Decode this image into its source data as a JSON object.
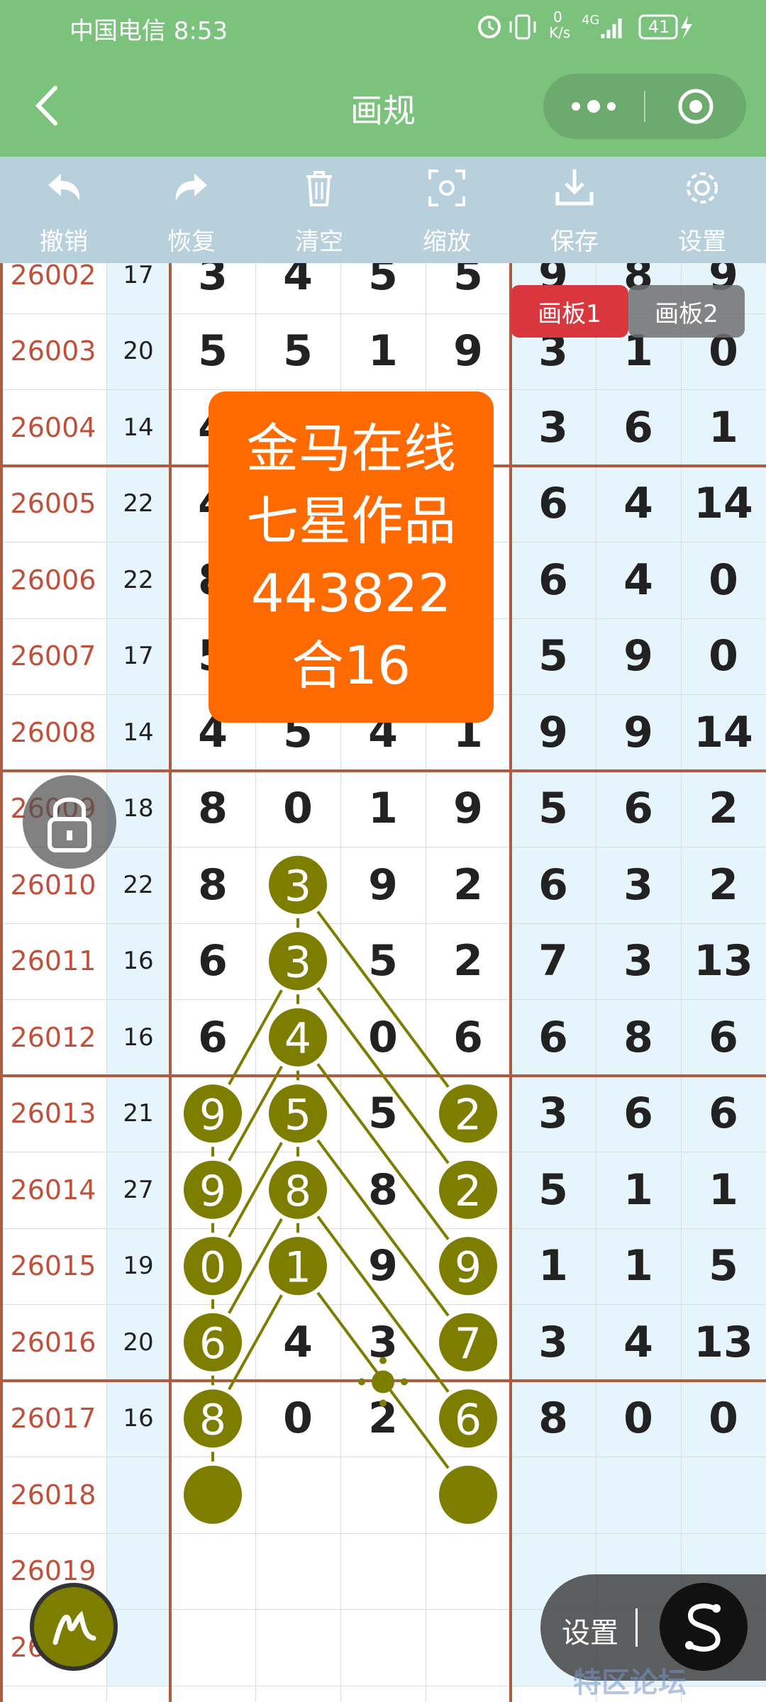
{
  "status_bar": {
    "carrier_time": "中国电信 8:53",
    "net_speed_value": "0",
    "net_speed_unit": "K/s",
    "network": "4G",
    "battery": "41"
  },
  "title_bar": {
    "title": "画规"
  },
  "toolbar": [
    {
      "label": "撤销",
      "icon": "undo-icon"
    },
    {
      "label": "恢复",
      "icon": "redo-icon"
    },
    {
      "label": "清空",
      "icon": "trash-icon"
    },
    {
      "label": "缩放",
      "icon": "zoom-icon"
    },
    {
      "label": "保存",
      "icon": "download-icon"
    },
    {
      "label": "设置",
      "icon": "gear-icon"
    }
  ],
  "board_tabs": [
    {
      "label": "画板1",
      "active": true
    },
    {
      "label": "画板2",
      "active": false
    }
  ],
  "card": {
    "line1": "金马在线",
    "line2": "七星作品",
    "line3": "443822",
    "line4": "合16"
  },
  "rows": [
    {
      "period": "26002",
      "sum": "17",
      "d": [
        "3",
        "4",
        "5",
        "5"
      ],
      "r": [
        "9",
        "8",
        "9"
      ]
    },
    {
      "period": "26003",
      "sum": "20",
      "d": [
        "5",
        "5",
        "1",
        "9"
      ],
      "r": [
        "3",
        "1",
        "0"
      ]
    },
    {
      "period": "26004",
      "sum": "14",
      "d": [
        "4",
        "",
        "",
        ""
      ],
      "r": [
        "3",
        "6",
        "1"
      ]
    },
    {
      "period": "26005",
      "sum": "22",
      "d": [
        "4",
        "",
        "",
        ""
      ],
      "r": [
        "6",
        "4",
        "14"
      ]
    },
    {
      "period": "26006",
      "sum": "22",
      "d": [
        "8",
        "",
        "",
        ""
      ],
      "r": [
        "6",
        "4",
        "0"
      ]
    },
    {
      "period": "26007",
      "sum": "17",
      "d": [
        "5",
        "",
        "",
        ""
      ],
      "r": [
        "5",
        "9",
        "0"
      ]
    },
    {
      "period": "26008",
      "sum": "14",
      "d": [
        "4",
        "5",
        "4",
        "1"
      ],
      "r": [
        "9",
        "9",
        "14"
      ]
    },
    {
      "period": "26009",
      "sum": "18",
      "d": [
        "8",
        "0",
        "1",
        "9"
      ],
      "r": [
        "5",
        "6",
        "2"
      ]
    },
    {
      "period": "26010",
      "sum": "22",
      "d": [
        "8",
        "",
        "9",
        "2"
      ],
      "r": [
        "6",
        "3",
        "2"
      ]
    },
    {
      "period": "26011",
      "sum": "16",
      "d": [
        "6",
        "",
        "5",
        "2"
      ],
      "r": [
        "7",
        "3",
        "13"
      ]
    },
    {
      "period": "26012",
      "sum": "16",
      "d": [
        "6",
        "",
        "0",
        "6"
      ],
      "r": [
        "6",
        "8",
        "6"
      ]
    },
    {
      "period": "26013",
      "sum": "21",
      "d": [
        "",
        "",
        "5",
        ""
      ],
      "r": [
        "3",
        "6",
        "6"
      ]
    },
    {
      "period": "26014",
      "sum": "27",
      "d": [
        "",
        "",
        "8",
        ""
      ],
      "r": [
        "5",
        "1",
        "1"
      ]
    },
    {
      "period": "26015",
      "sum": "19",
      "d": [
        "",
        "",
        "9",
        ""
      ],
      "r": [
        "1",
        "1",
        "5"
      ]
    },
    {
      "period": "26016",
      "sum": "20",
      "d": [
        "",
        "4",
        "3",
        ""
      ],
      "r": [
        "3",
        "4",
        "13"
      ]
    },
    {
      "period": "26017",
      "sum": "16",
      "d": [
        "",
        "0",
        "2",
        ""
      ],
      "r": [
        "8",
        "0",
        "0"
      ]
    },
    {
      "period": "26018",
      "sum": "",
      "d": [
        "",
        "",
        "",
        ""
      ],
      "r": [
        "",
        "",
        ""
      ]
    },
    {
      "period": "26019",
      "sum": "",
      "d": [
        "",
        "",
        "",
        ""
      ],
      "r": [
        "",
        "",
        ""
      ]
    },
    {
      "period": "26020",
      "sum": "",
      "d": [
        "",
        "",
        "",
        ""
      ],
      "r": [
        "",
        "",
        ""
      ]
    }
  ],
  "markers": [
    {
      "row": 8,
      "col": 1,
      "label": "3"
    },
    {
      "row": 9,
      "col": 1,
      "label": "3"
    },
    {
      "row": 10,
      "col": 1,
      "label": "4"
    },
    {
      "row": 11,
      "col": 0,
      "label": "9"
    },
    {
      "row": 11,
      "col": 1,
      "label": "5"
    },
    {
      "row": 11,
      "col": 3,
      "label": "2"
    },
    {
      "row": 12,
      "col": 0,
      "label": "9"
    },
    {
      "row": 12,
      "col": 1,
      "label": "8"
    },
    {
      "row": 12,
      "col": 3,
      "label": "2"
    },
    {
      "row": 13,
      "col": 0,
      "label": "0"
    },
    {
      "row": 13,
      "col": 1,
      "label": "1"
    },
    {
      "row": 13,
      "col": 3,
      "label": "9"
    },
    {
      "row": 14,
      "col": 0,
      "label": "6"
    },
    {
      "row": 14,
      "col": 3,
      "label": "7"
    },
    {
      "row": 15,
      "col": 0,
      "label": "8"
    },
    {
      "row": 15,
      "col": 3,
      "label": "6"
    },
    {
      "row": 16,
      "col": 0,
      "label": ""
    },
    {
      "row": 16,
      "col": 3,
      "label": ""
    }
  ],
  "bottom_pill": {
    "label": "设置",
    "icon": "s-curve-icon"
  },
  "watermark": "特区论坛",
  "colors": {
    "header_green": "#7bc27d",
    "toolbar_blue": "#b7d0dc",
    "marker_olive": "#7d7d00",
    "card_orange": "#ff6a00",
    "grid_red": "#b05a40",
    "period_red": "#c0503a",
    "tab_active": "#d9363e"
  }
}
